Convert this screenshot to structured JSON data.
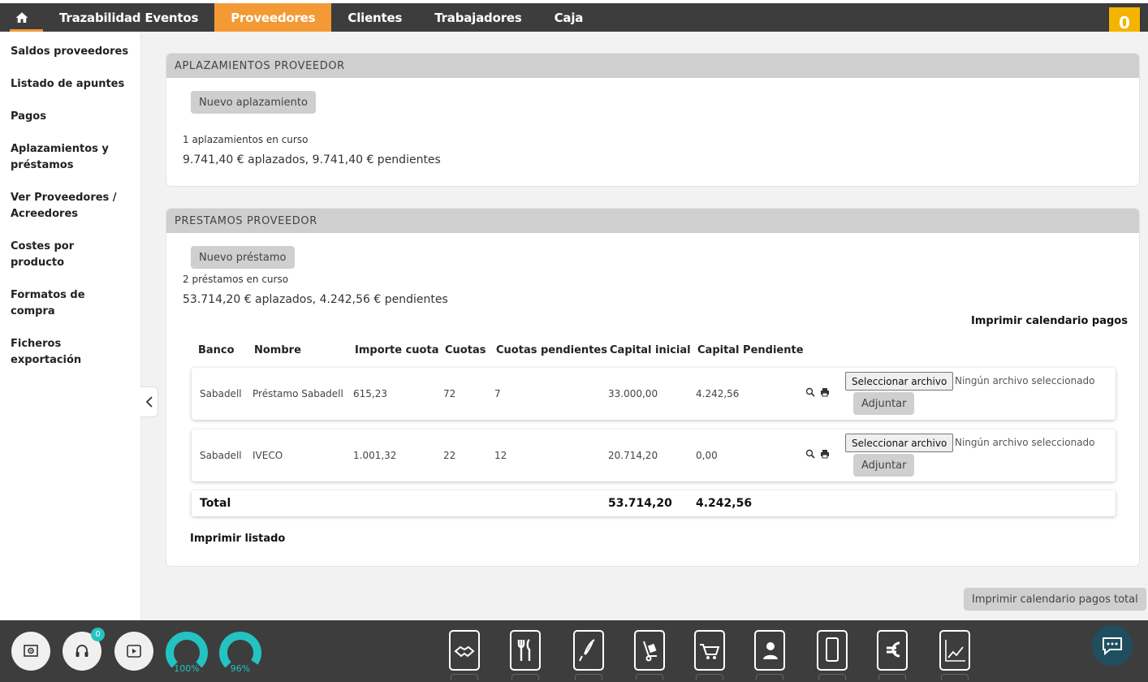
{
  "nav": {
    "items": [
      "Trazabilidad Eventos",
      "Proveedores",
      "Clientes",
      "Trabajadores",
      "Caja"
    ],
    "active_index": 1,
    "notes_count": "0"
  },
  "sidebar": {
    "items": [
      "Saldos proveedores",
      "Listado de apuntes",
      "Pagos",
      "Aplazamientos y préstamos",
      "Ver Proveedores / Acreedores",
      "Costes por producto",
      "Formatos de compra",
      "Ficheros exportación"
    ]
  },
  "aplazamientos": {
    "title": "APLAZAMIENTOS PROVEEDOR",
    "new_button": "Nuevo aplazamiento",
    "count_text": "1 aplazamientos en curso",
    "summary": "9.741,40 € aplazados, 9.741,40 € pendientes"
  },
  "prestamos": {
    "title": "PRESTAMOS PROVEEDOR",
    "new_button": "Nuevo préstamo",
    "count_text": "2 préstamos en curso",
    "summary": "53.714,20 € aplazados, 4.242,56 € pendientes",
    "print_calendar": "Imprimir calendario pagos",
    "columns": [
      "Banco",
      "Nombre",
      "Importe cuota",
      "Cuotas",
      "Cuotas pendientes",
      "Capital inicial",
      "Capital Pendiente"
    ],
    "rows": [
      {
        "banco": "Sabadell",
        "nombre": "Préstamo Sabadell",
        "importe": "615,23",
        "cuotas": "72",
        "pendientes": "7",
        "capital_inicial": "33.000,00",
        "capital_pendiente": "4.242,56"
      },
      {
        "banco": "Sabadell",
        "nombre": "IVECO",
        "importe": "1.001,32",
        "cuotas": "22",
        "pendientes": "12",
        "capital_inicial": "20.714,20",
        "capital_pendiente": "0,00"
      }
    ],
    "file_button": "Seleccionar archivo",
    "file_none": "Ningún archivo seleccionado",
    "attach_button": "Adjuntar",
    "total_label": "Total",
    "total_capital_inicial": "53.714,20",
    "total_capital_pendiente": "4.242,56",
    "print_list": "Imprimir listado"
  },
  "print_total_button": "Imprimir calendario pagos total",
  "bottom": {
    "support_badge": "0",
    "gauge1": "100%",
    "gauge1_value": 1.0,
    "gauge2": "96%",
    "gauge2_value": 0.96,
    "modules": [
      "handshake-icon",
      "cutlery-icon",
      "whisk-icon",
      "hand-truck-icon",
      "cart-icon",
      "contact-icon",
      "mobile-icon",
      "euro-icon",
      "chart-icon"
    ]
  },
  "colors": {
    "accent": "#f39a36",
    "topbar": "#3d3d3d",
    "teal": "#24c2c0",
    "note": "#f5b400"
  }
}
